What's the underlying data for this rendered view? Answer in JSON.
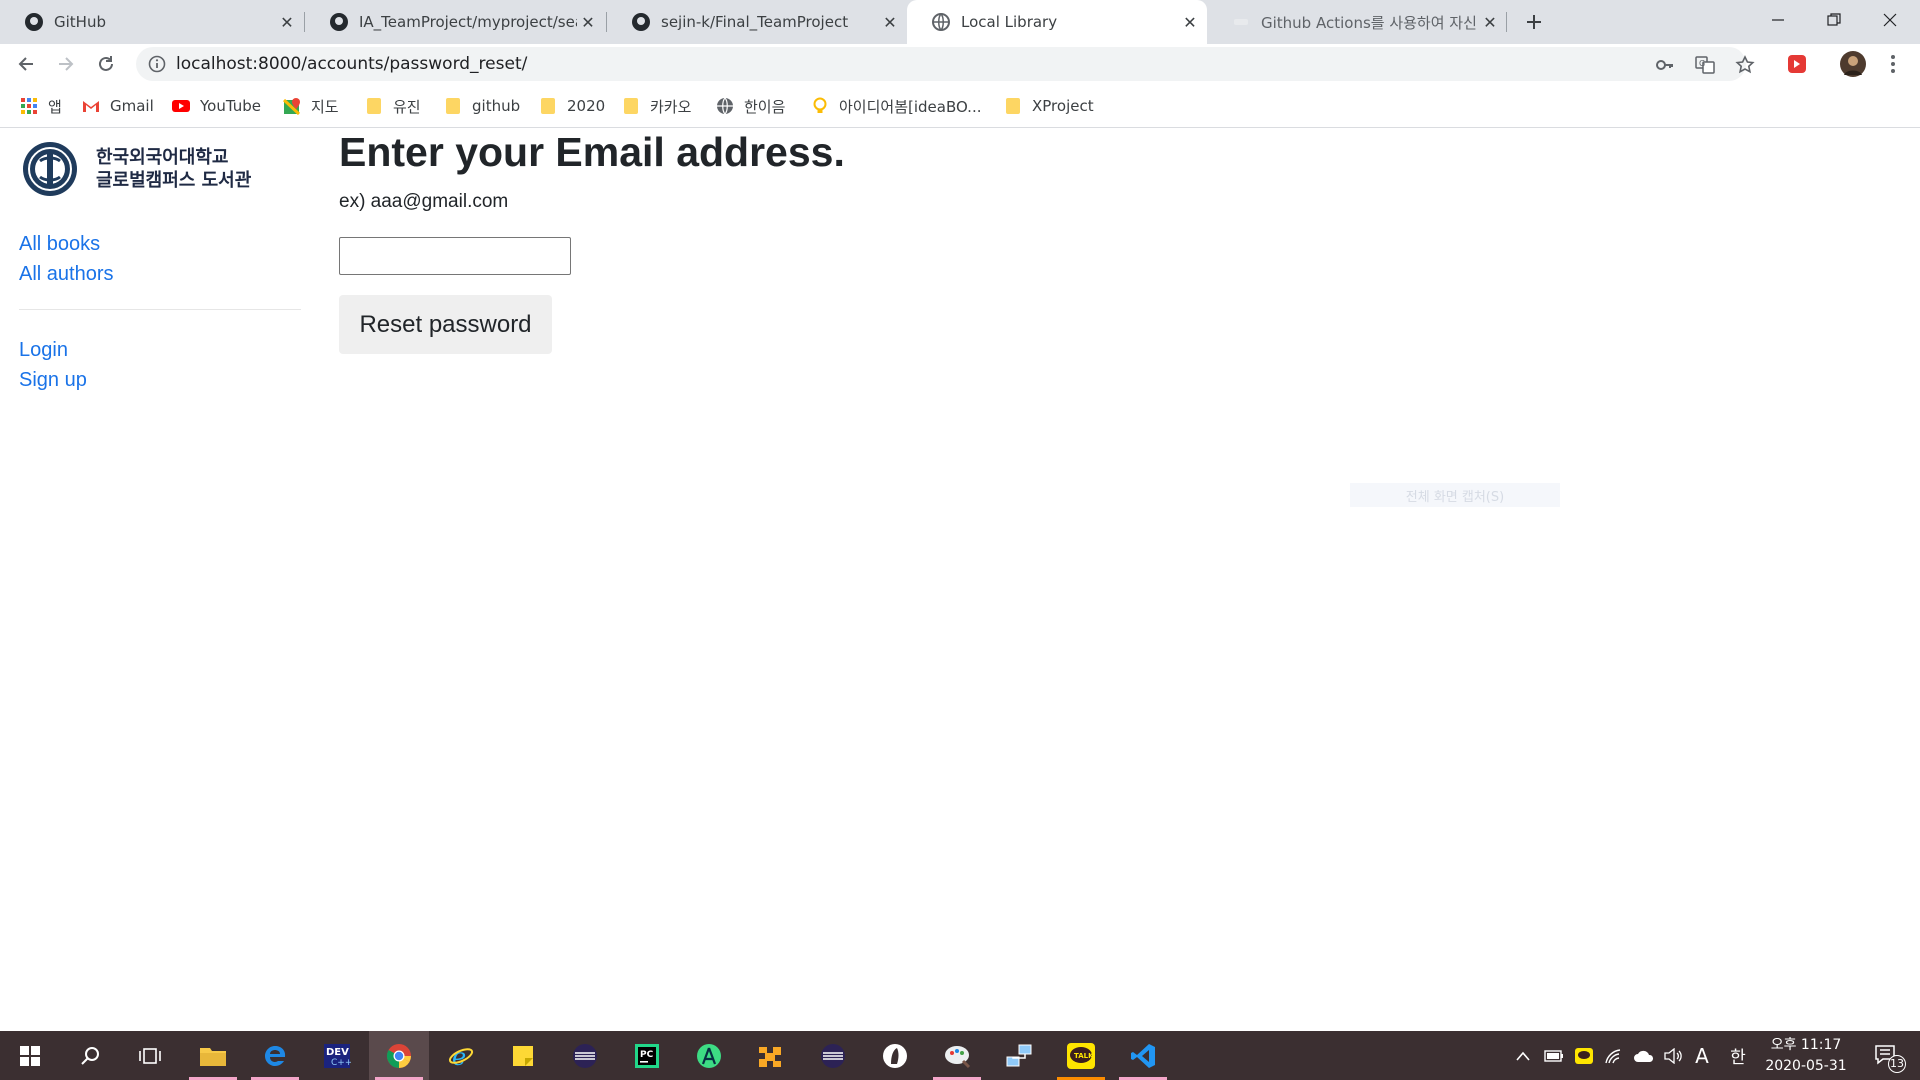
{
  "browser": {
    "tabs": [
      {
        "title": "GitHub",
        "icon": "github-icon"
      },
      {
        "title": "IA_TeamProject/myproject/searc",
        "icon": "github-icon"
      },
      {
        "title": "sejin-k/Final_TeamProject",
        "icon": "github-icon"
      },
      {
        "title": "Local Library",
        "icon": "globe-icon"
      },
      {
        "title": "Github Actions를 사용하여 자신",
        "icon": "loading-icon"
      }
    ],
    "url": "localhost:8000/accounts/password_reset/",
    "bookmarks": [
      {
        "label": "앱",
        "icon": "apps-icon"
      },
      {
        "label": "Gmail",
        "icon": "gmail-icon"
      },
      {
        "label": "YouTube",
        "icon": "youtube-icon"
      },
      {
        "label": "지도",
        "icon": "maps-icon"
      },
      {
        "label": "유진",
        "icon": "folder-icon"
      },
      {
        "label": "github",
        "icon": "folder-icon"
      },
      {
        "label": "2020",
        "icon": "folder-icon"
      },
      {
        "label": "카카오",
        "icon": "folder-icon"
      },
      {
        "label": "한이음",
        "icon": "globe-icon"
      },
      {
        "label": "아이디어봄[ideaBO...",
        "icon": "lightbulb-icon"
      },
      {
        "label": "XProject",
        "icon": "folder-icon"
      }
    ]
  },
  "site": {
    "logo_line1": "한국외국어대학교",
    "logo_line2": "글로벌캠퍼스 도서관",
    "nav": {
      "all_books": "All books",
      "all_authors": "All authors",
      "login": "Login",
      "signup": "Sign up"
    }
  },
  "form": {
    "heading": "Enter your Email address.",
    "example": "ex) aaa@gmail.com",
    "email_value": "",
    "submit_label": "Reset password"
  },
  "overlay": {
    "ghost_text": "전체 화면 캡처(S)"
  },
  "taskbar": {
    "apps": [
      "windows-start-icon",
      "search-icon",
      "task-view-icon",
      "file-explorer-icon",
      "edge-icon",
      "devcpp-icon",
      "chrome-icon",
      "ie-icon",
      "sticky-notes-icon",
      "eclipse-icon",
      "pycharm-icon",
      "android-studio-icon",
      "app-icon",
      "eclipse-icon",
      "app-icon",
      "paint-icon",
      "network-icon",
      "kakaotalk-icon",
      "vscode-icon"
    ],
    "ime_label": "A",
    "ime_mode": "한",
    "time": "오후 11:17",
    "date": "2020-05-31",
    "notifications": "13"
  },
  "colors": {
    "link": "#1a73e8",
    "tabstrip": "#dee1e6",
    "taskbar": "#3b2f31"
  }
}
